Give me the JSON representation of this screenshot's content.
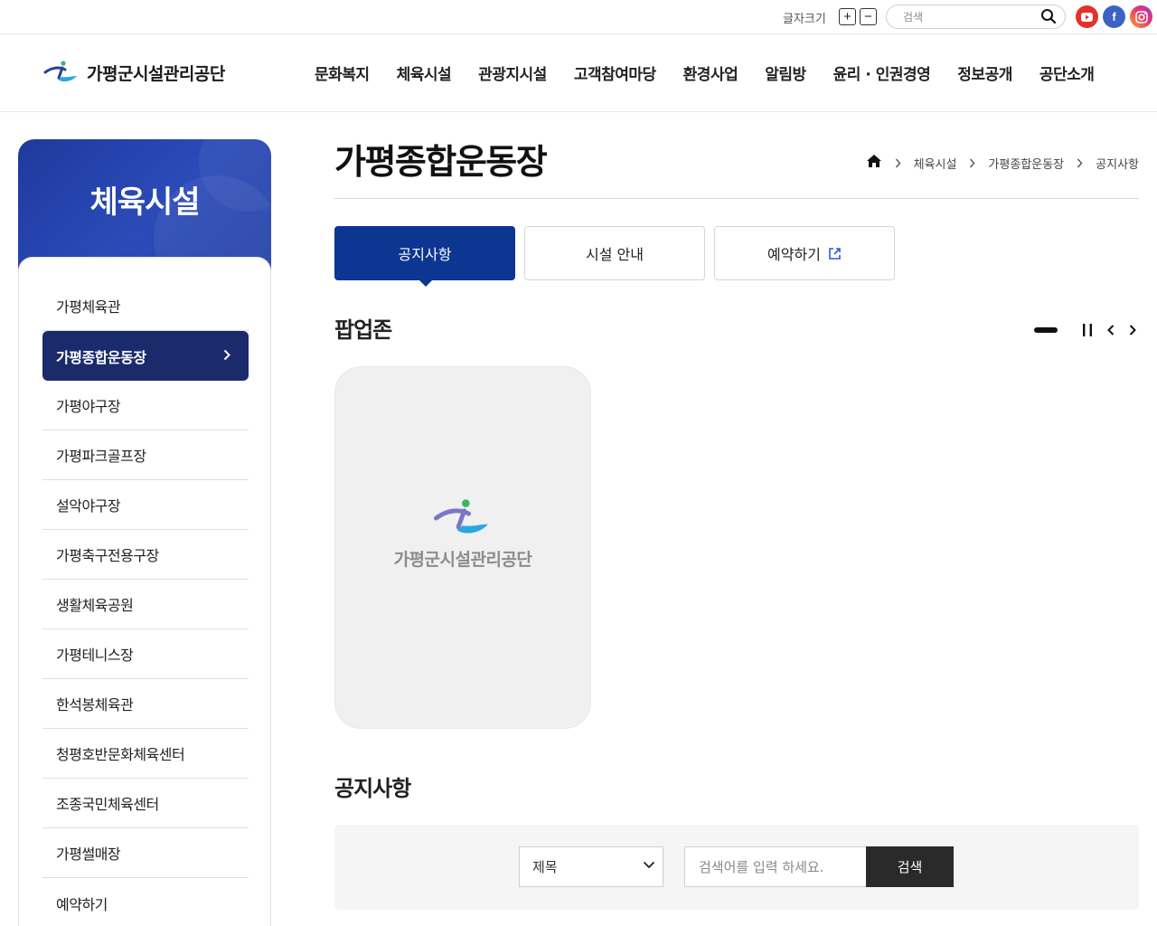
{
  "utility": {
    "font_size_label": "글자크기",
    "plus": "+",
    "minus": "−",
    "search_placeholder": "검색"
  },
  "header": {
    "logo_text": "가평군시설관리공단",
    "nav": [
      "문화복지",
      "체육시설",
      "관광지시설",
      "고객참여마당",
      "환경사업",
      "알림방",
      "윤리 · 인권경영",
      "정보공개",
      "공단소개"
    ]
  },
  "sidebar": {
    "title": "체육시설",
    "items": [
      "가평체육관",
      "가평종합운동장",
      "가평야구장",
      "가평파크골프장",
      "설악야구장",
      "가평축구전용구장",
      "생활체육공원",
      "가평테니스장",
      "한석봉체육관",
      "청평호반문화체육센터",
      "조종국민체육센터",
      "가평썰매장",
      "예약하기"
    ],
    "active_index": 1
  },
  "content": {
    "page_title": "가평종합운동장",
    "breadcrumb": [
      "체육시설",
      "가평종합운동장",
      "공지사항"
    ],
    "tabs": [
      "공지사항",
      "시설 안내",
      "예약하기"
    ],
    "popup_title": "팝업존",
    "popup_logo_text": "가평군시설관리공단",
    "notice_title": "공지사항",
    "search": {
      "select_value": "제목",
      "input_placeholder": "검색어를 입력 하세요.",
      "button_label": "검색"
    }
  },
  "colors": {
    "primary": "#0d3592",
    "sidebar_active": "#1b2a6b",
    "sidebar_header": "#2b4bb8"
  }
}
